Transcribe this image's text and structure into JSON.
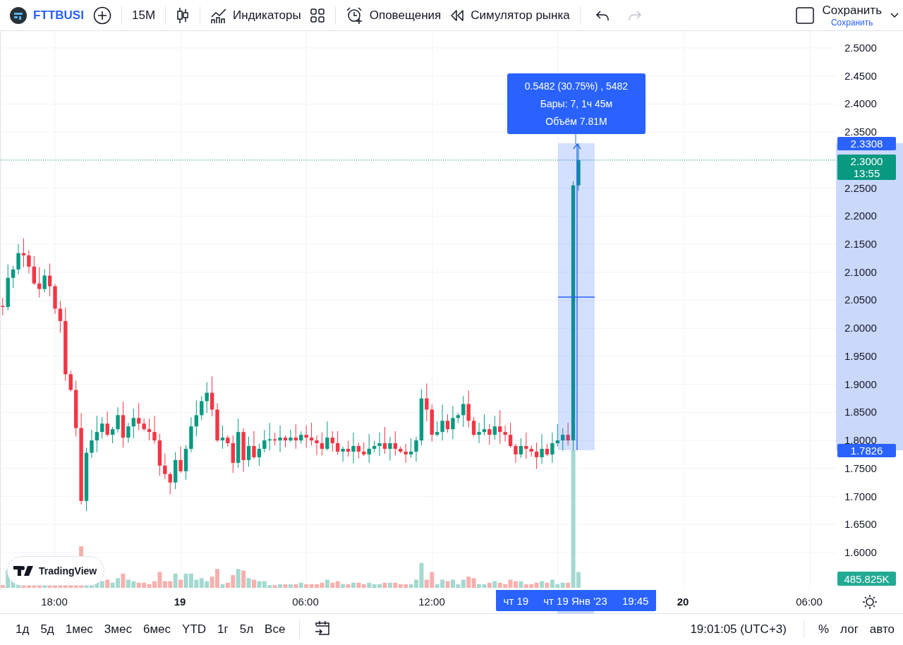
{
  "toolbar": {
    "symbol": "FTTBUSI",
    "interval": "15M",
    "indicators_label": "Индикаторы",
    "alerts_label": "Оповещения",
    "replay_label": "Симулятор рынка",
    "history": [
      {
        "kind": "undo",
        "disabled": false
      },
      {
        "kind": "redo",
        "disabled": true
      }
    ],
    "save": {
      "label": "Сохранить",
      "sublabel": "Сохранить"
    }
  },
  "chart": {
    "price_labels": [
      "2.5000",
      "2.4500",
      "2.4000",
      "2.3500",
      "2.2500",
      "2.2000",
      "2.1500",
      "2.1000",
      "2.0500",
      "2.0000",
      "1.9500",
      "1.9000",
      "1.8500",
      "1.8000",
      "1.7500",
      "1.7000",
      "1.6500",
      "1.6000"
    ],
    "time_labels": [
      {
        "label": "18:00",
        "bold": false
      },
      {
        "label": "19",
        "bold": true
      },
      {
        "label": "06:00",
        "bold": false
      },
      {
        "label": "12:00",
        "bold": false
      },
      {
        "label": "20",
        "bold": true
      },
      {
        "label": "06:00",
        "bold": false
      }
    ],
    "measure": {
      "lines": [
        "0.5482 (30.75%) , 5482",
        "Бары: 7, 1ч 45м",
        "Объём 7.81M"
      ]
    },
    "price_badges": [
      {
        "kind": "measure",
        "label": "2.3308"
      },
      {
        "kind": "last",
        "label": "2.3000",
        "countdown": "13:55"
      },
      {
        "kind": "measure",
        "label": "1.7826"
      },
      {
        "kind": "volume",
        "label": "485.825K"
      }
    ],
    "time_badge": [
      "чт 19",
      "чт 19 Янв '23",
      "19:45"
    ],
    "logo": "TradingView"
  },
  "bottom_bar": {
    "ranges": [
      "1д",
      "5д",
      "1мес",
      "3мес",
      "6мес",
      "YTD",
      "1г",
      "5л",
      "Все"
    ],
    "clock": "19:01:05 (UTC+3)",
    "scale_options": [
      "%",
      "лог",
      "авто"
    ]
  }
}
